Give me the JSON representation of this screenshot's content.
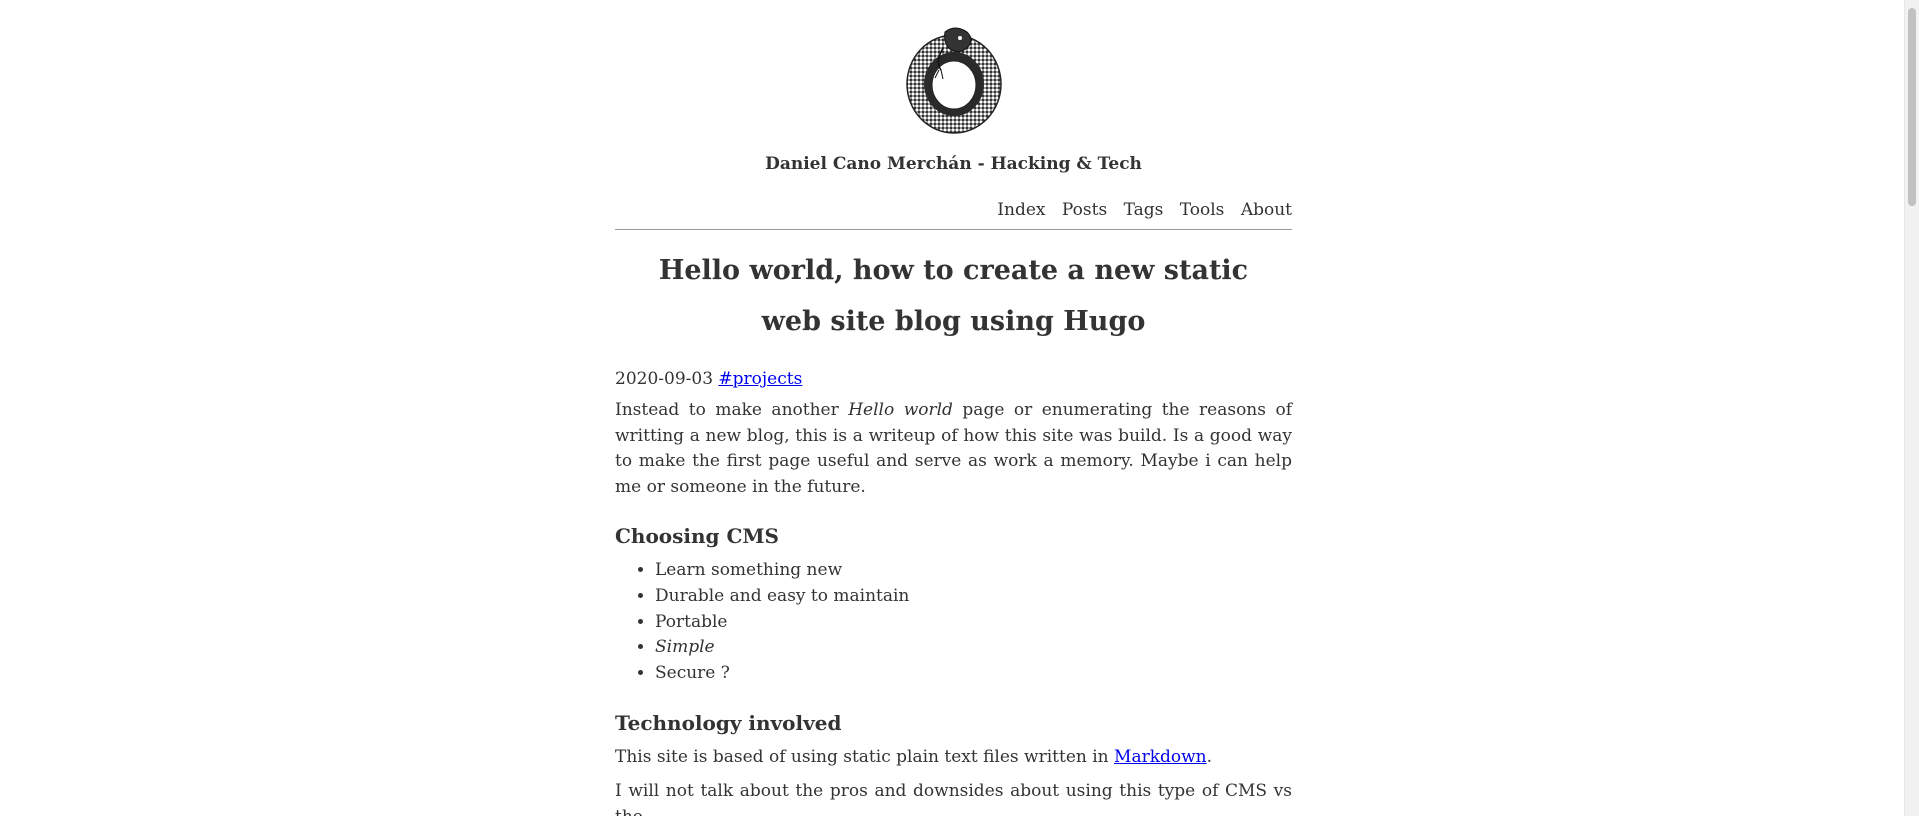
{
  "header": {
    "logo_icon": "ouroboros-snake-icon",
    "site_title": "Daniel Cano Merchán - Hacking & Tech"
  },
  "nav": {
    "items": [
      {
        "label": "Index"
      },
      {
        "label": "Posts"
      },
      {
        "label": "Tags"
      },
      {
        "label": "Tools"
      },
      {
        "label": "About"
      }
    ]
  },
  "post": {
    "title": "Hello world, how to create a new static web site blog using Hugo",
    "date": "2020-09-03",
    "tag": "#projects",
    "intro": {
      "before": "Instead to make another ",
      "emphasis": "Hello world",
      "after": " page or enumerating the reasons of writting a new blog, this is a writeup of how this site was build. Is a good way to make the first page useful and serve as work a memory. Maybe i can help me or someone in the future."
    },
    "section1": {
      "heading": "Choosing CMS",
      "items": [
        "Learn something new",
        "Durable and easy to maintain",
        "Portable",
        "Simple",
        "Secure ?"
      ]
    },
    "section2": {
      "heading": "Technology involved",
      "paragraph_before": "This site is based of using static plain text files written in ",
      "link": "Markdown",
      "paragraph_after": ".",
      "next_paragraph": "I will not talk about the pros and downsides about using this type of CMS vs the"
    }
  },
  "colors": {
    "text": "#333333",
    "link": "#0000ee",
    "divider": "#999999"
  }
}
